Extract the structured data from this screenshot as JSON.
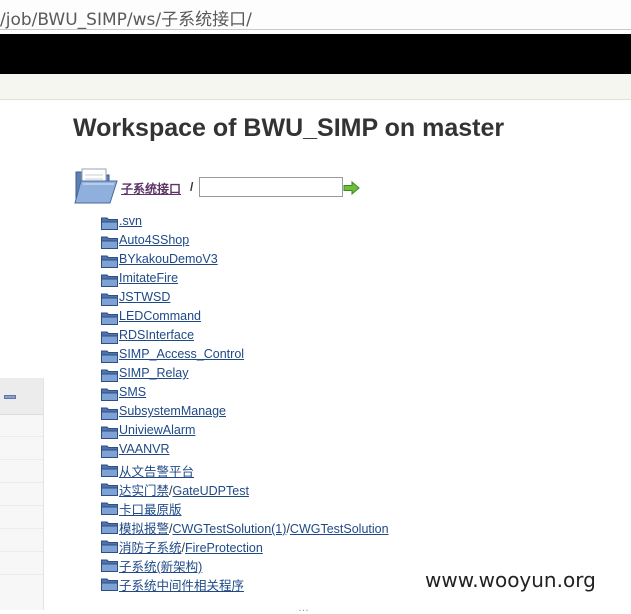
{
  "browser": {
    "url": "/job/BWU_SIMP/ws/子系统接口/"
  },
  "page": {
    "title": "Workspace of BWU_SIMP on master"
  },
  "path": {
    "current_link": "子系统接口",
    "separator": "/",
    "input_value": "",
    "go_icon": "green-arrow-right-icon"
  },
  "files": [
    {
      "parts": [
        ".svn"
      ]
    },
    {
      "parts": [
        "Auto4SShop"
      ]
    },
    {
      "parts": [
        "BYkakouDemoV3"
      ]
    },
    {
      "parts": [
        "ImitateFire"
      ]
    },
    {
      "parts": [
        "JSTWSD"
      ]
    },
    {
      "parts": [
        "LEDCommand"
      ]
    },
    {
      "parts": [
        "RDSInterface"
      ]
    },
    {
      "parts": [
        "SIMP_Access_Control"
      ]
    },
    {
      "parts": [
        "SIMP_Relay"
      ]
    },
    {
      "parts": [
        "SMS"
      ]
    },
    {
      "parts": [
        "SubsystemManage"
      ]
    },
    {
      "parts": [
        "UniviewAlarm"
      ]
    },
    {
      "parts": [
        "VAANVR"
      ]
    },
    {
      "parts": [
        "从文告警平台"
      ]
    },
    {
      "parts": [
        "达实门禁",
        "GateUDPTest"
      ]
    },
    {
      "parts": [
        "卡口最原版"
      ]
    },
    {
      "parts": [
        "模拟报警",
        "CWGTestSolution(1)",
        "CWGTestSolution"
      ]
    },
    {
      "parts": [
        "消防子系统",
        "FireProtection"
      ]
    },
    {
      "parts": [
        "子系统(新架构)"
      ]
    },
    {
      "parts": [
        "子系统中间件相关程序"
      ]
    }
  ],
  "watermark": "www.wooyun.org",
  "footer_fragment": "…",
  "colors": {
    "link": "#204a87",
    "visited_link": "#5c3566",
    "header_bar": "#000000"
  }
}
